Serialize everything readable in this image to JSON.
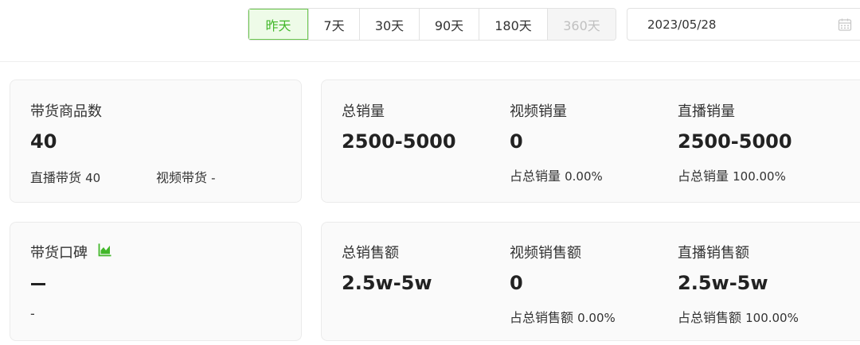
{
  "toolbar": {
    "ranges": [
      {
        "label": "昨天",
        "state": "active"
      },
      {
        "label": "7天",
        "state": "normal"
      },
      {
        "label": "30天",
        "state": "normal"
      },
      {
        "label": "90天",
        "state": "normal"
      },
      {
        "label": "180天",
        "state": "normal"
      },
      {
        "label": "360天",
        "state": "disabled"
      }
    ],
    "date_value": "2023/05/28",
    "date_icon": "calendar-icon"
  },
  "colors": {
    "accent": "#42b72a",
    "accent_bg": "#eefbe8",
    "card_bg": "#fafafa",
    "disabled_text": "#c0c0c0"
  },
  "goods_card": {
    "title": "带货商品数",
    "value": "40",
    "live_label": "直播带货",
    "live_value": "40",
    "video_label": "视频带货",
    "video_value": "-"
  },
  "sales_card": {
    "total_label": "总销量",
    "total_value": "2500-5000",
    "video_label": "视频销量",
    "video_value": "0",
    "video_share_label": "占总销量",
    "video_share_value": "0.00%",
    "live_label": "直播销量",
    "live_value": "2500-5000",
    "live_share_label": "占总销量",
    "live_share_value": "100.00%"
  },
  "reputation_card": {
    "title": "带货口碑",
    "icon": "area-chart-icon",
    "value": "—",
    "sub": "-"
  },
  "amount_card": {
    "total_label": "总销售额",
    "total_value": "2.5w-5w",
    "video_label": "视频销售额",
    "video_value": "0",
    "video_share_label": "占总销售额",
    "video_share_value": "0.00%",
    "live_label": "直播销售额",
    "live_value": "2.5w-5w",
    "live_share_label": "占总销售额",
    "live_share_value": "100.00%"
  }
}
